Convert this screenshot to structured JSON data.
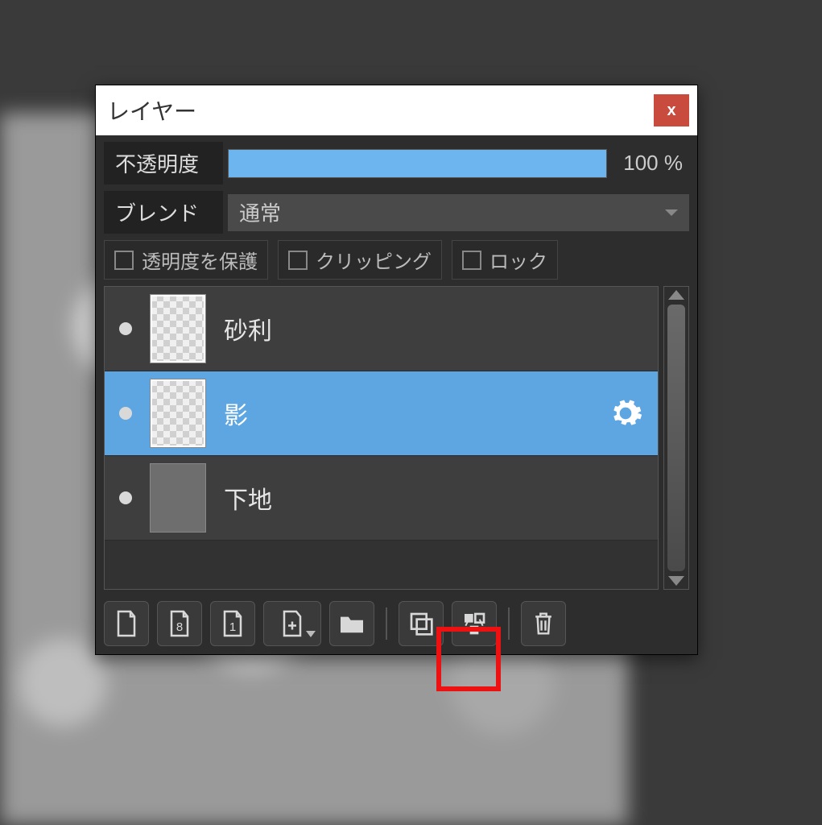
{
  "panel": {
    "title": "レイヤー",
    "close": "x"
  },
  "opacity": {
    "label": "不透明度",
    "value": "100 %"
  },
  "blend": {
    "label": "ブレンド",
    "mode": "通常"
  },
  "checks": {
    "protect_alpha": "透明度を保護",
    "clipping": "クリッピング",
    "lock": "ロック"
  },
  "layers": [
    {
      "name": "砂利",
      "selected": false,
      "thumb": "checker",
      "has_gear": false
    },
    {
      "name": "影",
      "selected": true,
      "thumb": "checker",
      "has_gear": true
    },
    {
      "name": "下地",
      "selected": false,
      "thumb": "solid",
      "has_gear": false
    }
  ],
  "tools": {
    "new_layer": "new-layer",
    "layer_8": "8",
    "layer_1": "1",
    "add_special": "add-special",
    "folder": "folder",
    "duplicate": "duplicate",
    "merge": "merge",
    "delete": "delete"
  }
}
